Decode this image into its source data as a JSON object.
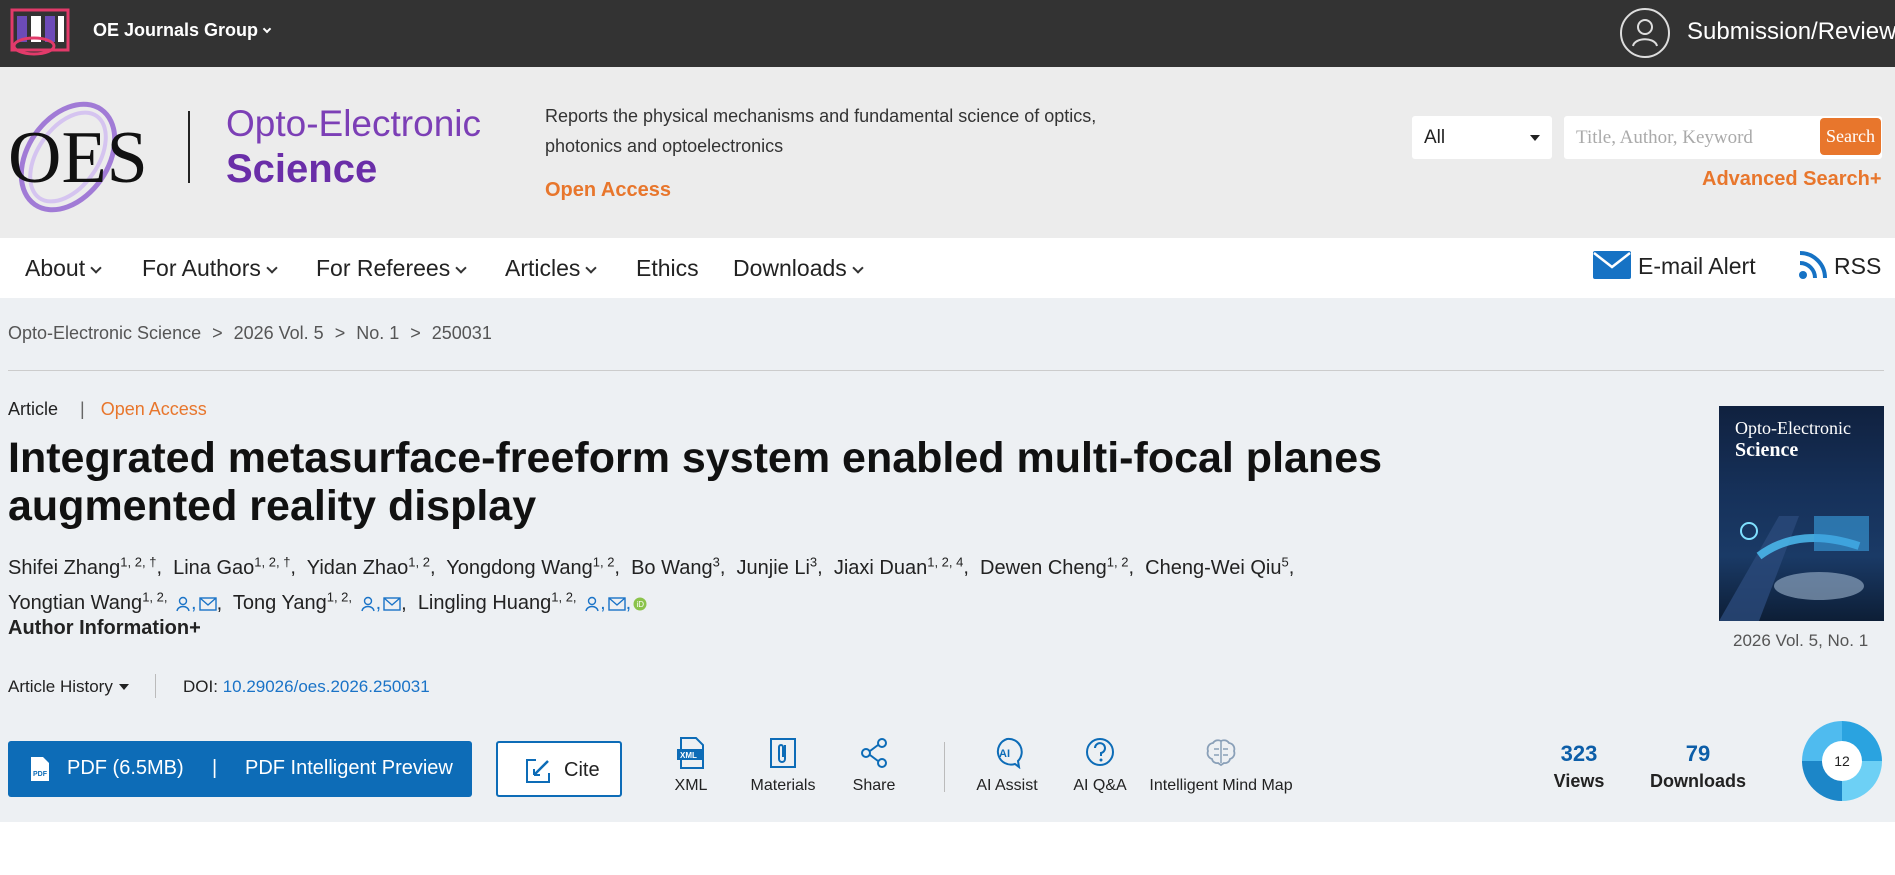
{
  "topbar": {
    "group_name": "OE Journals Group",
    "submission_label": "Submission/Review"
  },
  "header": {
    "brand_line1": "Opto-Electronic",
    "brand_line2": "Science",
    "tagline": "Reports the physical mechanisms and fundamental science of optics, photonics and optoelectronics",
    "open_access": "Open Access",
    "search_scope": "All",
    "search_placeholder": "Title, Author, Keyword",
    "search_button": "Search",
    "advanced_search": "Advanced Search+"
  },
  "nav": {
    "about": "About",
    "for_authors": "For Authors",
    "for_referees": "For Referees",
    "articles": "Articles",
    "ethics": "Ethics",
    "downloads": "Downloads",
    "email_alert": "E-mail Alert",
    "rss": "RSS"
  },
  "breadcrumb": {
    "items": [
      "Opto-Electronic Science",
      "2026 Vol. 5",
      "No. 1",
      "250031"
    ],
    "separator": ">"
  },
  "article": {
    "type": "Article",
    "access": "Open Access",
    "title": "Integrated metasurface-freeform system enabled multi-focal planes augmented reality display",
    "authors": [
      {
        "name": "Shifei Zhang",
        "sup": "1, 2, †"
      },
      {
        "name": "Lina Gao",
        "sup": "1, 2, †"
      },
      {
        "name": "Yidan Zhao",
        "sup": "1, 2"
      },
      {
        "name": "Yongdong Wang",
        "sup": "1, 2"
      },
      {
        "name": "Bo Wang",
        "sup": "3"
      },
      {
        "name": "Junjie Li",
        "sup": "3"
      },
      {
        "name": "Jiaxi Duan",
        "sup": "1, 2, 4"
      },
      {
        "name": "Dewen Cheng",
        "sup": "1, 2"
      },
      {
        "name": "Cheng-Wei Qiu",
        "sup": "5"
      },
      {
        "name": "Yongtian Wang",
        "sup": "1, 2,"
      },
      {
        "name": "Tong Yang",
        "sup": "1, 2,"
      },
      {
        "name": "Lingling Huang",
        "sup": "1, 2,"
      }
    ],
    "author_info_label": "Author Information+",
    "history_label": "Article History",
    "doi_label": "DOI:",
    "doi_value": "10.29026/oes.2026.250031"
  },
  "cover": {
    "title_line1": "Opto-Electronic",
    "title_line2": "Science",
    "caption": "2026 Vol. 5, No. 1"
  },
  "actions": {
    "pdf_label": "PDF (6.5MB)",
    "pdf_sep": "|",
    "pdf_preview": "PDF Intelligent Preview",
    "cite": "Cite",
    "xml": "XML",
    "materials": "Materials",
    "share": "Share",
    "ai_assist": "AI Assist",
    "ai_qa": "AI Q&A",
    "mind_map": "Intelligent Mind Map"
  },
  "stats": {
    "views": "323",
    "views_label": "Views",
    "downloads": "79",
    "downloads_label": "Downloads",
    "altmetric_score": "12"
  },
  "colors": {
    "accent_orange": "#e8762c",
    "brand_purple": "#7c3fb6",
    "primary_blue": "#0d6cb7",
    "link_blue": "#1a73c7",
    "topbar_bg": "#333333"
  }
}
